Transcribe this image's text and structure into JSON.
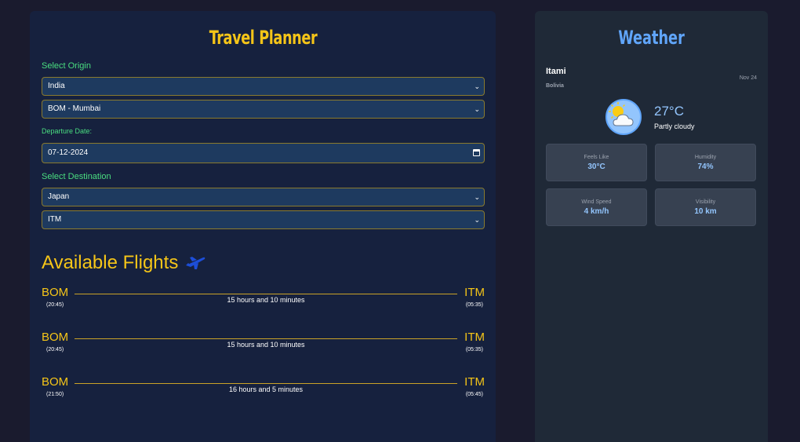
{
  "planner": {
    "title": "Travel Planner",
    "origin_label": "Select Origin",
    "origin_country": "India",
    "origin_airport": "BOM - Mumbai",
    "departure_label": "Departure Date:",
    "departure_date": "07-12-2024",
    "destination_label": "Select Destination",
    "destination_country": "Japan",
    "destination_airport": "ITM"
  },
  "flights": {
    "heading": "Available Flights",
    "items": [
      {
        "from": "BOM",
        "dep": "(20:45)",
        "to": "ITM",
        "arr": "(05:35)",
        "duration": "15 hours and 10 minutes"
      },
      {
        "from": "BOM",
        "dep": "(20:45)",
        "to": "ITM",
        "arr": "(05:35)",
        "duration": "15 hours and 10 minutes"
      },
      {
        "from": "BOM",
        "dep": "(21:50)",
        "to": "ITM",
        "arr": "(05:45)",
        "duration": "16 hours and 5 minutes"
      }
    ]
  },
  "weather": {
    "title": "Weather",
    "city": "Itami",
    "country": "Bolivia",
    "date": "Nov 24",
    "temperature": "27°C",
    "condition": "Partly cloudy",
    "icon": "partly-cloudy-icon",
    "stats": [
      {
        "label": "Feels Like",
        "value": "30°C"
      },
      {
        "label": "Humidity",
        "value": "74%"
      },
      {
        "label": "Wind Speed",
        "value": "4 km/h"
      },
      {
        "label": "Visibility",
        "value": "10 km"
      }
    ]
  },
  "colors": {
    "accent_gold": "#f5c518",
    "accent_green": "#4ade80",
    "accent_blue": "#60a5fa"
  }
}
